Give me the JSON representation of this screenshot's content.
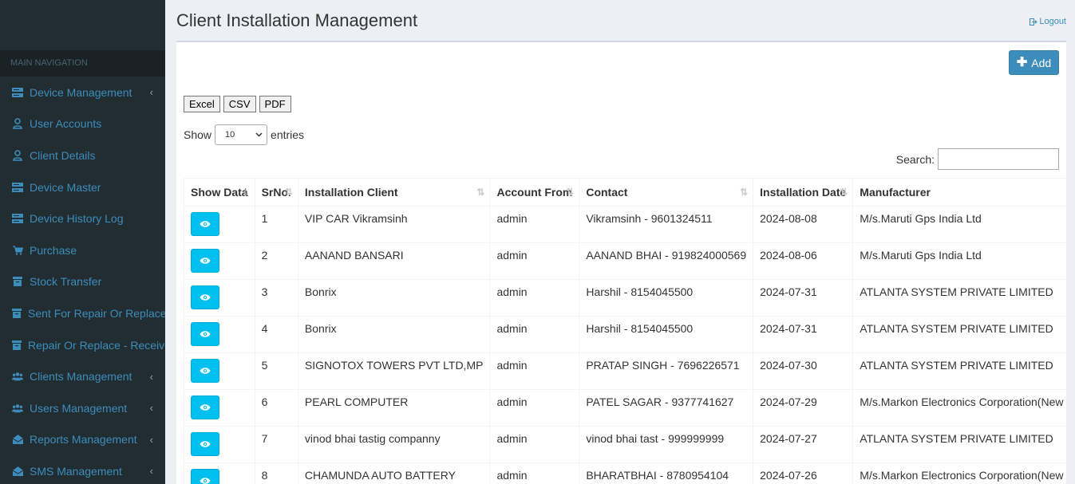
{
  "page": {
    "title": "Client Installation Management",
    "logout_label": "Logout"
  },
  "sidebar": {
    "header": "MAIN NAVIGATION",
    "items": [
      {
        "label": "Device Management",
        "icon": "server-icon",
        "has_children": true
      },
      {
        "label": "User Accounts",
        "icon": "user-icon",
        "has_children": false
      },
      {
        "label": "Client Details",
        "icon": "user-icon",
        "has_children": false
      },
      {
        "label": "Device Master",
        "icon": "server-icon",
        "has_children": false
      },
      {
        "label": "Device History Log",
        "icon": "server-icon",
        "has_children": false
      },
      {
        "label": "Purchase",
        "icon": "cart-icon",
        "has_children": false
      },
      {
        "label": "Stock Transfer",
        "icon": "archive-icon",
        "has_children": false
      },
      {
        "label": "Sent For Repair Or Replace",
        "icon": "archive-icon",
        "has_children": false
      },
      {
        "label": "Repair Or Replace - Received",
        "icon": "archive-icon",
        "has_children": false
      },
      {
        "label": "Clients Management",
        "icon": "users-icon",
        "has_children": true
      },
      {
        "label": "Users Management",
        "icon": "users-icon",
        "has_children": true
      },
      {
        "label": "Reports Management",
        "icon": "envelope-open-icon",
        "has_children": true
      },
      {
        "label": "SMS Management",
        "icon": "envelope-open-icon",
        "has_children": true
      }
    ]
  },
  "toolbar": {
    "add_label": "Add",
    "export": [
      "Excel",
      "CSV",
      "PDF"
    ]
  },
  "length": {
    "show_label": "Show",
    "value": "10",
    "entries_label": "entries"
  },
  "search": {
    "label": "Search:",
    "value": ""
  },
  "table": {
    "headers": [
      "Show Data",
      "SrNo.",
      "Installation Client",
      "Account From",
      "Contact",
      "Installation Date",
      "Manufacturer"
    ],
    "rows": [
      [
        "1",
        "VIP CAR Vikramsinh",
        "admin",
        "Vikramsinh - 9601324511",
        "2024-08-08",
        "M/s.Maruti Gps India Ltd"
      ],
      [
        "2",
        "AANAND BANSARI",
        "admin",
        "AANAND BHAI - 919824000569",
        "2024-08-06",
        "M/s.Maruti Gps India Ltd"
      ],
      [
        "3",
        "Bonrix",
        "admin",
        "Harshil - 8154045500",
        "2024-07-31",
        "ATLANTA SYSTEM PRIVATE LIMITED"
      ],
      [
        "4",
        "Bonrix",
        "admin",
        "Harshil - 8154045500",
        "2024-07-31",
        "ATLANTA SYSTEM PRIVATE LIMITED"
      ],
      [
        "5",
        "SIGNOTOX TOWERS PVT LTD,MP",
        "admin",
        "PRATAP SINGH - 7696226571",
        "2024-07-30",
        "ATLANTA SYSTEM PRIVATE LIMITED"
      ],
      [
        "6",
        "PEARL COMPUTER",
        "admin",
        "PATEL SAGAR - 9377741627",
        "2024-07-29",
        "M/s.Markon Electronics Corporation(New Delhi)"
      ],
      [
        "7",
        "vinod bhai tastig compannу",
        "admin",
        "vinod bhai tast - 999999999",
        "2024-07-27",
        "ATLANTA SYSTEM PRIVATE LIMITED"
      ],
      [
        "8",
        "CHAMUNDA AUTO BATTERY",
        "admin",
        "BHARATBHAI - 8780954104",
        "2024-07-26",
        "M/s.Markon Electronics Corporation(New Delhi)"
      ]
    ]
  },
  "colors": {
    "sidebar_bg": "#222d32",
    "accent": "#3c8dbc",
    "view_button": "#00c0ef"
  }
}
